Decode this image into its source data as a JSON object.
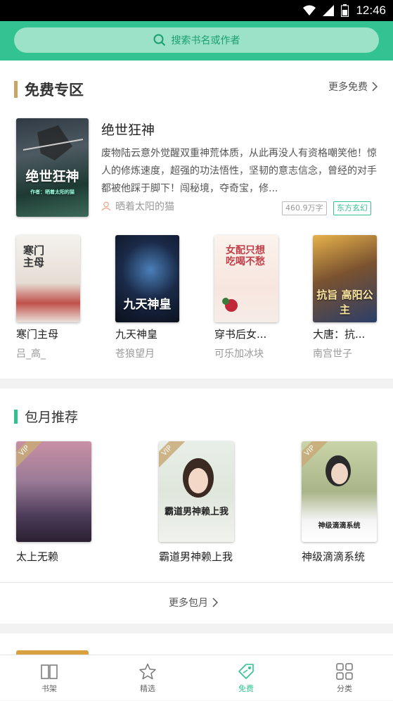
{
  "status_bar": {
    "time": "12:46"
  },
  "search": {
    "placeholder": "搜索书名或作者"
  },
  "free_section": {
    "title": "免费专区",
    "more_label": "更多免费",
    "featured": {
      "title": "绝世狂神",
      "description": "废物陆云意外觉醒双重神荒体质，从此再没人有资格嘲笑他！惊人的修炼速度，超强的功法悟性，坚韧的意志信念，曾经的对手都被他踩于脚下！闯秘境，夺奇宝，修...",
      "author": "晒着太阳的猫",
      "word_count": "460.9万字",
      "category": "东方玄幻",
      "cover_text": "绝世狂神",
      "cover_sub": "作者：晒着太阳的猫"
    },
    "books": [
      {
        "title": "寒门主母",
        "author": "吕_高_",
        "cover_text": "寒门主母"
      },
      {
        "title": "九天神皇",
        "author": "苍狼望月",
        "cover_text": "九天神皇"
      },
      {
        "title": "穿书后女...",
        "author": "可乐加冰块",
        "cover_text": "女配只想吃喝不愁"
      },
      {
        "title": "大唐：抗...",
        "author": "南宫世子",
        "cover_text": "抗旨 高阳公主"
      }
    ]
  },
  "monthly_section": {
    "title": "包月推荐",
    "more_label": "更多包月",
    "vip_label": "VIP",
    "books": [
      {
        "title": "太上无赖",
        "cover_text": ""
      },
      {
        "title": "霸道男神赖上我",
        "cover_text": "霸道男神赖上我"
      },
      {
        "title": "神级滴滴系统",
        "cover_text": "神级滴滴系统"
      }
    ]
  },
  "tabs": [
    {
      "label": "书架",
      "icon": "book-icon"
    },
    {
      "label": "精选",
      "icon": "star-icon"
    },
    {
      "label": "免费",
      "icon": "tag-icon"
    },
    {
      "label": "分类",
      "icon": "grid-icon"
    }
  ],
  "colors": {
    "accent": "#33c393",
    "free_bar": "#c9a46a",
    "monthly_bar": "#33c393",
    "category_tag": "#33c393",
    "count_tag": "#aaaaaa"
  }
}
